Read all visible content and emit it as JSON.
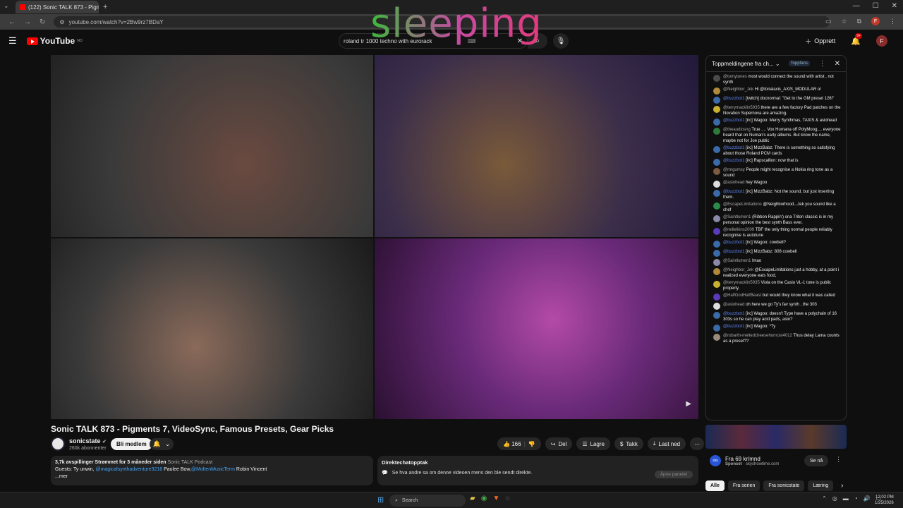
{
  "browser": {
    "tab_title": "(122) Sonic TALK 873 - Pigm",
    "url": "youtube.com/watch?v=2Bw9rz7BDaY"
  },
  "overlay_text": "sleeping",
  "youtube": {
    "logo": "YouTube",
    "logo_region": "NO",
    "search_value": "roland tr 1000 techno with eurorack",
    "create_label": "Opprett",
    "notif_badge": "9+",
    "avatar_letter": "F"
  },
  "video": {
    "title": "Sonic TALK 873 - Pigments 7, VideoSync, Famous Presets, Gear Picks",
    "channel": "sonicstate",
    "subscribers": "260k abonnenter",
    "member_label": "Bli medlem",
    "likes": "166",
    "share_label": "Del",
    "save_label": "Lagre",
    "thanks_label": "Takk",
    "download_label": "Last ned"
  },
  "description": {
    "stats": "3,7k avspillinger  Strømmet for 3 måneder siden",
    "podcast": "Sonic TALK Podcast",
    "guests_prefix": "Guests: Ty unwin,",
    "guest_link1": "@magicalsynthadventure3216",
    "guest2": "Paulee Bow,",
    "guest_link2": "@MoltenMusicTerm",
    "guest3": "Robin Vincent",
    "more": "...mer"
  },
  "replay": {
    "title": "Direktechatopptak",
    "body": "Se hva andre sa om denne videoen mens den ble sendt direkte.",
    "open_label": "Åpne panelet"
  },
  "chat": {
    "header": "Toppmeldingene fra ch...",
    "badge": "Toppfans",
    "messages": [
      {
        "user": "@tomytones",
        "text": "most would connect the sound with artist , not synth",
        "color": "#4a4a4a",
        "blue": false
      },
      {
        "user": "@Neighbor_Jek",
        "text": "Hi @tonalaxis_AXIS_MODULAR o/",
        "color": "#b08a3a",
        "blue": false
      },
      {
        "user": "@buzzbot1",
        "text": "[twitch] docnormal: \"Get to the GM preset 126!\"",
        "color": "#3a6aa8",
        "blue": true
      },
      {
        "user": "@terrymacklin5935",
        "text": "there are a few factory Pad patches on the Novation Supernova are amazing.",
        "color": "#c8b030",
        "blue": false
      },
      {
        "user": "@buzzbot1",
        "text": "[irc] Wagoo: Merry Synthmas, TAXIS & asiohead",
        "color": "#3a6aa8",
        "blue": true
      },
      {
        "user": "@theaudiosng",
        "text": "True .... Vox Humana off PolyMoog.... everyone heard that on Numan's early albums. But know the name, maybe not for Joe public",
        "color": "#2f7a3a",
        "blue": false
      },
      {
        "user": "@buzzbot1",
        "text": "[irc] MizzBabz: There is something so satisfying about those Roland PCM cards",
        "color": "#3a6aa8",
        "blue": true
      },
      {
        "user": "@buzzbot1",
        "text": "[irc] Rapscallion: now that is",
        "color": "#3a6aa8",
        "blue": true
      },
      {
        "user": "@mrgumsy",
        "text": "People might recognise a Nokia ring tone as a sound",
        "color": "#7a5a40",
        "blue": false
      },
      {
        "user": "@asiohead",
        "text": "hey Wagoo",
        "color": "#dddddd",
        "blue": false
      },
      {
        "user": "@buzzbot1",
        "text": "[irc] MizzBabz: Not the sound, but just inserting them.",
        "color": "#3a6aa8",
        "blue": true
      },
      {
        "user": "@EscapeLimitations",
        "text": "@Neighborhood...Jek you sound like a chef",
        "color": "#2a8a4a",
        "blue": false
      },
      {
        "user": "@Saintlumen1",
        "text": "(Ribbon Rappin') ona Triton classic is in my personal opinion the best synth Bass ever.",
        "color": "#8a8aa8",
        "blue": false
      },
      {
        "user": "@reillelkins2009",
        "text": "TBF the only thing normal people reliably recognise is autotune",
        "color": "#5a3ab8",
        "blue": false
      },
      {
        "user": "@buzzbot1",
        "text": "[irc] Wagoo: cowbell?",
        "color": "#3a6aa8",
        "blue": true
      },
      {
        "user": "@buzzbot1",
        "text": "[irc] MizzBabz: 808 cowbell",
        "color": "#3a6aa8",
        "blue": true
      },
      {
        "user": "@Saintlumen1",
        "text": "lmao",
        "color": "#8a8aa8",
        "blue": false
      },
      {
        "user": "@Neighbor_Jek",
        "text": "@EscapeLimitations just a hobby, at a point i realized everyone eats food,",
        "color": "#b08a3a",
        "blue": false
      },
      {
        "user": "@terrymacklin5935",
        "text": "Viola on the Casio VL-1 tone is public property.",
        "color": "#c8b030",
        "blue": false
      },
      {
        "user": "@HalfGodHalfBeast",
        "text": "but would they know what it was called",
        "color": "#5a3ab8",
        "blue": false
      },
      {
        "user": "@asiohead",
        "text": "oh here we go Ty's fav synth , the 303",
        "color": "#dddddd",
        "blue": false
      },
      {
        "user": "@buzzbot1",
        "text": "[irc] Wagoo: doesn't Type have a polychain of 16 303s so he can play acid pads, asio?",
        "color": "#3a6aa8",
        "blue": true
      },
      {
        "user": "@buzzbot1",
        "text": "[irc] Wagoo: *Ty",
        "color": "#3a6aa8",
        "blue": true
      },
      {
        "user": "@robarth-meltedcheesehornost4012",
        "text": "Thus delay Lama counts as a preset??",
        "color": "#9a8a7a",
        "blue": false
      }
    ]
  },
  "ad": {
    "title": "Fra 69 kr/mnd",
    "sponsor": "Sponset",
    "domain": "skyshowtime.com",
    "logo_text": "sky",
    "cta": "Se nå"
  },
  "chips": [
    "Alle",
    "Fra serien",
    "Fra sonicstate",
    "Læring"
  ],
  "taskbar": {
    "search": "Search",
    "time": "12:02 PM",
    "date": "1/25/2026"
  }
}
